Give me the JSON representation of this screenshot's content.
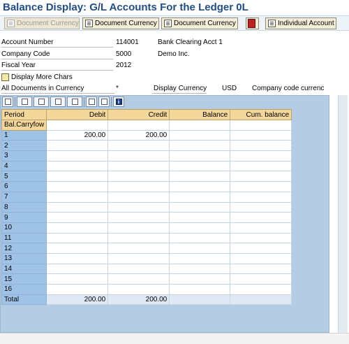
{
  "title": "Balance Display: G/L Accounts For the Ledger 0L",
  "toolbar": {
    "buttons": [
      {
        "label": "Document Currency",
        "icon": "document-icon",
        "enabled": false
      },
      {
        "label": "Document Currency",
        "icon": "document-icon",
        "enabled": true
      },
      {
        "label": "Document Currency",
        "icon": "document-icon",
        "enabled": true
      },
      {
        "label": "",
        "icon": "red-grid-icon",
        "enabled": true
      },
      {
        "label": "Individual Account",
        "icon": "document-icon",
        "enabled": true
      }
    ]
  },
  "header": {
    "account_number_label": "Account Number",
    "account_number": "114001",
    "account_name": "Bank Clearing Acct 1",
    "company_code_label": "Company Code",
    "company_code": "5000",
    "company_name": "Demo Inc.",
    "fiscal_year_label": "Fiscal Year",
    "fiscal_year": "2012",
    "more_chars_label": "Display More Chars",
    "all_docs_label": "All Documents in Currency",
    "all_docs_value": "*",
    "display_currency_label": "Display Currency",
    "display_currency_value": "USD",
    "currency_note": "Company code currenc"
  },
  "grid": {
    "columns": [
      "Period",
      "Debit",
      "Credit",
      "Balance",
      "Cum. balance"
    ],
    "rows": [
      {
        "period": "Bal.Carryfow",
        "debit": "",
        "credit": "",
        "balance": "",
        "cum": ""
      },
      {
        "period": "1",
        "debit": "200.00",
        "credit": "200.00",
        "balance": "",
        "cum": ""
      },
      {
        "period": "2",
        "debit": "",
        "credit": "",
        "balance": "",
        "cum": ""
      },
      {
        "period": "3",
        "debit": "",
        "credit": "",
        "balance": "",
        "cum": ""
      },
      {
        "period": "4",
        "debit": "",
        "credit": "",
        "balance": "",
        "cum": ""
      },
      {
        "period": "5",
        "debit": "",
        "credit": "",
        "balance": "",
        "cum": ""
      },
      {
        "period": "6",
        "debit": "",
        "credit": "",
        "balance": "",
        "cum": ""
      },
      {
        "period": "7",
        "debit": "",
        "credit": "",
        "balance": "",
        "cum": ""
      },
      {
        "period": "8",
        "debit": "",
        "credit": "",
        "balance": "",
        "cum": ""
      },
      {
        "period": "9",
        "debit": "",
        "credit": "",
        "balance": "",
        "cum": ""
      },
      {
        "period": "10",
        "debit": "",
        "credit": "",
        "balance": "",
        "cum": ""
      },
      {
        "period": "11",
        "debit": "",
        "credit": "",
        "balance": "",
        "cum": ""
      },
      {
        "period": "12",
        "debit": "",
        "credit": "",
        "balance": "",
        "cum": ""
      },
      {
        "period": "13",
        "debit": "",
        "credit": "",
        "balance": "",
        "cum": ""
      },
      {
        "period": "14",
        "debit": "",
        "credit": "",
        "balance": "",
        "cum": ""
      },
      {
        "period": "15",
        "debit": "",
        "credit": "",
        "balance": "",
        "cum": ""
      },
      {
        "period": "16",
        "debit": "",
        "credit": "",
        "balance": "",
        "cum": ""
      },
      {
        "period": "Total",
        "debit": "200.00",
        "credit": "200.00",
        "balance": "",
        "cum": ""
      }
    ]
  },
  "colors": {
    "title": "#1f4d8a",
    "header_cell": "#f4d79a",
    "period_cell": "#9fc3e6",
    "grid_background": "#b4cde5"
  }
}
